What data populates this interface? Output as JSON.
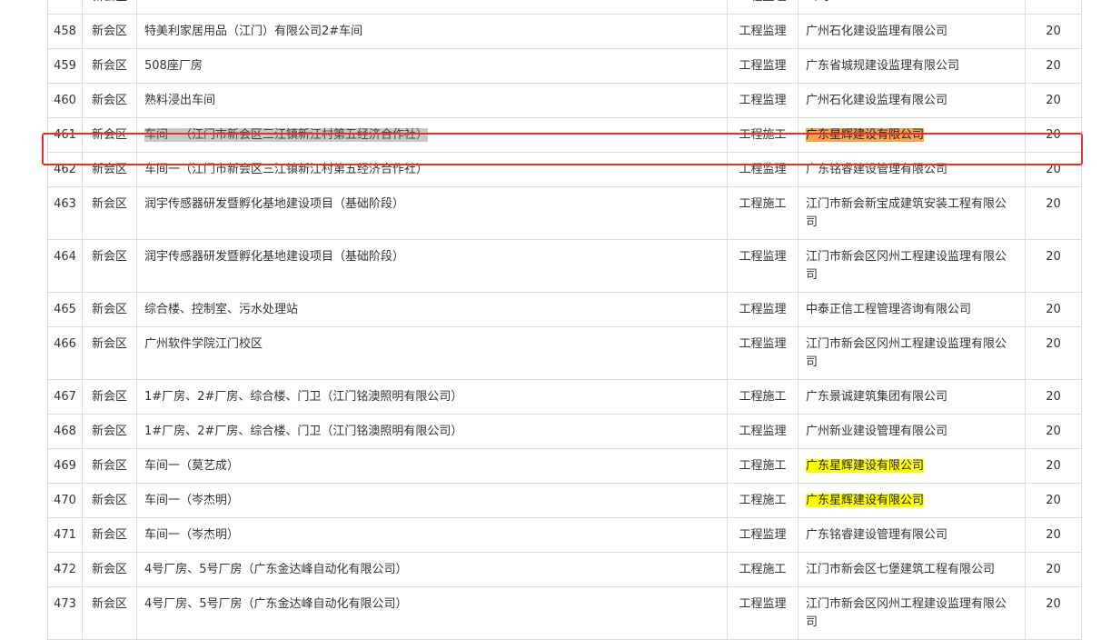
{
  "table": {
    "rows": [
      {
        "no": "",
        "district": "新会区",
        "project": "",
        "type": "工程监理",
        "company": "公司",
        "company_highlight": "",
        "project_highlight": "",
        "score": ""
      },
      {
        "no": "458",
        "district": "新会区",
        "project": "特美利家居用品（江门）有限公司2#车间",
        "type": "工程监理",
        "company": "广州石化建设监理有限公司",
        "company_highlight": "",
        "project_highlight": "",
        "score": "20"
      },
      {
        "no": "459",
        "district": "新会区",
        "project": "508座厂房",
        "type": "工程监理",
        "company": "广东省城规建设监理有限公司",
        "company_highlight": "",
        "project_highlight": "",
        "score": "20"
      },
      {
        "no": "460",
        "district": "新会区",
        "project": "熟料浸出车间",
        "type": "工程监理",
        "company": "广州石化建设监理有限公司",
        "company_highlight": "",
        "project_highlight": "",
        "score": "20"
      },
      {
        "no": "461",
        "district": "新会区",
        "project": "车间一（江门市新会区三江镇新江村第五经济合作社）",
        "type": "工程施工",
        "company": "广东星辉建设有限公司",
        "company_highlight": "orange",
        "project_highlight": "gray",
        "score": "20"
      },
      {
        "no": "462",
        "district": "新会区",
        "project": "车间一（江门市新会区三江镇新江村第五经济合作社）",
        "type": "工程监理",
        "company": "广东铭睿建设管理有限公司",
        "company_highlight": "",
        "project_highlight": "",
        "score": "20"
      },
      {
        "no": "463",
        "district": "新会区",
        "project": "润宇传感器研发暨孵化基地建设项目（基础阶段）",
        "type": "工程施工",
        "company": "江门市新会新宝成建筑安装工程有限公司",
        "company_highlight": "",
        "project_highlight": "",
        "score": "20"
      },
      {
        "no": "464",
        "district": "新会区",
        "project": "润宇传感器研发暨孵化基地建设项目（基础阶段）",
        "type": "工程监理",
        "company": "江门市新会区冈州工程建设监理有限公司",
        "company_highlight": "",
        "project_highlight": "",
        "score": "20"
      },
      {
        "no": "465",
        "district": "新会区",
        "project": "综合楼、控制室、污水处理站",
        "type": "工程监理",
        "company": "中泰正信工程管理咨询有限公司",
        "company_highlight": "",
        "project_highlight": "",
        "score": "20"
      },
      {
        "no": "466",
        "district": "新会区",
        "project": "广州软件学院江门校区",
        "type": "工程监理",
        "company": "江门市新会区冈州工程建设监理有限公司",
        "company_highlight": "",
        "project_highlight": "",
        "score": "20"
      },
      {
        "no": "467",
        "district": "新会区",
        "project": "1#厂房、2#厂房、综合楼、门卫（江门铭澳照明有限公司）",
        "type": "工程施工",
        "company": "广东景诚建筑集团有限公司",
        "company_highlight": "",
        "project_highlight": "",
        "score": "20"
      },
      {
        "no": "468",
        "district": "新会区",
        "project": "1#厂房、2#厂房、综合楼、门卫（江门铭澳照明有限公司）",
        "type": "工程监理",
        "company": "广州新业建设管理有限公司",
        "company_highlight": "",
        "project_highlight": "",
        "score": "20"
      },
      {
        "no": "469",
        "district": "新会区",
        "project": "车间一（莫艺成）",
        "type": "工程施工",
        "company": "广东星辉建设有限公司",
        "company_highlight": "yellow",
        "project_highlight": "",
        "score": "20"
      },
      {
        "no": "470",
        "district": "新会区",
        "project": "车间一（岑杰明）",
        "type": "工程施工",
        "company": "广东星辉建设有限公司",
        "company_highlight": "yellow",
        "project_highlight": "",
        "score": "20"
      },
      {
        "no": "471",
        "district": "新会区",
        "project": "车间一（岑杰明）",
        "type": "工程监理",
        "company": "广东铭睿建设管理有限公司",
        "company_highlight": "",
        "project_highlight": "",
        "score": "20"
      },
      {
        "no": "472",
        "district": "新会区",
        "project": "4号厂房、5号厂房（广东金达峰自动化有限公司）",
        "type": "工程施工",
        "company": "江门市新会区七堡建筑工程有限公司",
        "company_highlight": "",
        "project_highlight": "",
        "score": "20"
      },
      {
        "no": "473",
        "district": "新会区",
        "project": "4号厂房、5号厂房（广东金达峰自动化有限公司）",
        "type": "工程监理",
        "company": "江门市新会区冈州工程建设监理有限公司",
        "company_highlight": "",
        "project_highlight": "",
        "score": "20"
      }
    ]
  },
  "colors": {
    "highlight_yellow": "#ffff00",
    "highlight_orange": "#f7a44a",
    "selection_border": "#e8302a",
    "grid_line": "#dcdcdc"
  }
}
